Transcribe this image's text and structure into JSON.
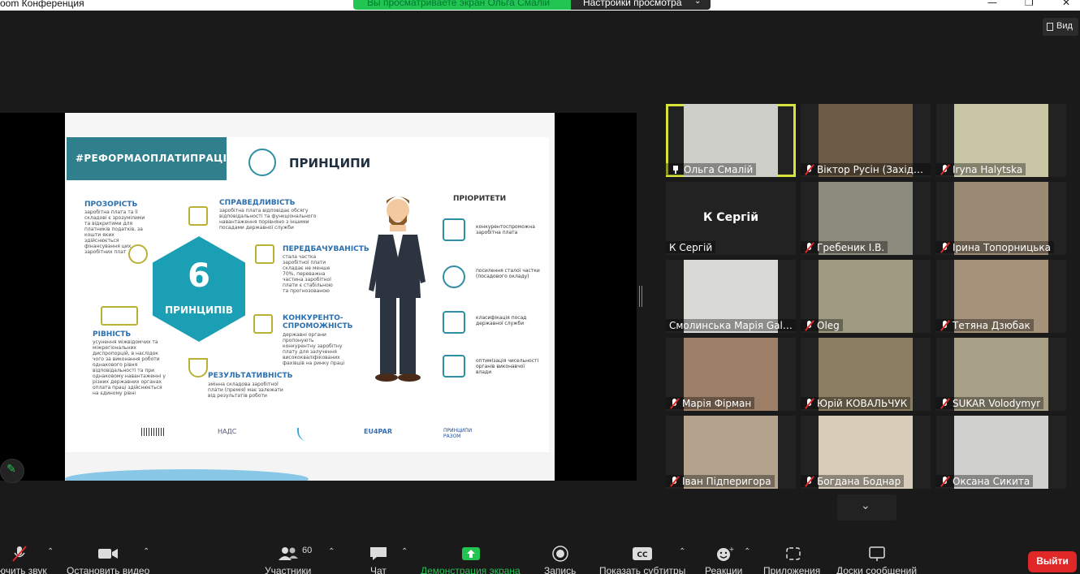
{
  "window": {
    "title": "oom Конференция",
    "share_banner": "Вы просматриваете экран Ольга Смалій",
    "view_settings": "Настройки просмотра",
    "view_button": "Вид"
  },
  "slide": {
    "hashtag": "#РЕФОРМАОПЛАТИПРАЦІ",
    "title": "ПРИНЦИПИ",
    "hex_number": "6",
    "hex_label": "ПРИНЦИПІВ",
    "principles": [
      {
        "heading": "ПРОЗОРІСТЬ",
        "text": "заробітна плата та її складові є зрозумілими та відкритими для платників податків, за кошти яких здійснюється фінансування цих заробітних плат"
      },
      {
        "heading": "СПРАВЕДЛИВІСТЬ",
        "text": "заробітна плата відповідає обсягу відповідальності та функціонального навантаження порівняно з іншими посадами державної служби"
      },
      {
        "heading": "ПЕРЕДБАЧУВАНІСТЬ",
        "text": "стала частка заробітної плати складає не менше 70%, переважна частина заробітної плати є стабільною та прогнозованою"
      },
      {
        "heading": "КОНКУРЕНТО-СПРОМОЖНІСТЬ",
        "text": "державні органи пропонують конкурентну заробітну плату для залучення висококваліфікованих фахівців на ринку праці"
      },
      {
        "heading": "РЕЗУЛЬТАТИВНІСТЬ",
        "text": "змінна складова заробітної плати (премія) має залежати від результатів роботи"
      },
      {
        "heading": "РІВНІСТЬ",
        "text": "усунення міжвідомчих та міжрегіональних диспропорцій, в наслідок чого за виконання роботи однакового рівня відповідальності та при однаковому навантаженні у різних державних органах оплата праці здійснюється на єдиному рівні"
      }
    ],
    "priorities_title": "ПРІОРИТЕТИ",
    "priorities": [
      "конкурентоспроможна заробітна плата",
      "посилення сталої частки (посадового окладу)",
      "класифікація посад державної служби",
      "оптимізація чисельності органів виконавчої влади"
    ],
    "logos": [
      "НАДС",
      "EU4PAR",
      "ПРИНЦИПИ РАЗОМ"
    ]
  },
  "participants": [
    {
      "name": "Ольга Смалій",
      "muted": false,
      "pinned": true,
      "active": true,
      "bg": "#cfcfc9"
    },
    {
      "name": "Віктор Русін (Західно...",
      "muted": true,
      "bg": "#6b5a44"
    },
    {
      "name": "Iryna Halytska",
      "muted": true,
      "bg": "#c9c6a5"
    },
    {
      "name": "К Сергій",
      "muted": false,
      "bg": "#222222",
      "avatar_text": "К Сергій"
    },
    {
      "name": "Гребеник І.В.",
      "muted": true,
      "bg": "#8c8a7c"
    },
    {
      "name": "Ірина Топорницька",
      "muted": true,
      "bg": "#9b8b74"
    },
    {
      "name": "Смолинська Марія Gala...",
      "muted": false,
      "bg": "#d9d9d6"
    },
    {
      "name": "Oleg",
      "muted": true,
      "bg": "#9e9b82"
    },
    {
      "name": "Тетяна Дзюбак",
      "muted": true,
      "bg": "#a6927a"
    },
    {
      "name": "Марія Фірман",
      "muted": true,
      "bg": "#9c7f66"
    },
    {
      "name": "Юрій КОВАЛЬЧУК",
      "muted": true,
      "bg": "#8a7d62"
    },
    {
      "name": "SUKAR Volodymyr",
      "muted": true,
      "bg": "#a89f87"
    },
    {
      "name": "Іван Підперигора",
      "muted": true,
      "bg": "#b3a38c"
    },
    {
      "name": "Богдана Боднар",
      "muted": true,
      "bg": "#d8cdb8"
    },
    {
      "name": "Оксана Сикита",
      "muted": true,
      "bg": "#d0d0ce"
    }
  ],
  "toolbar": {
    "mute": "ючить звук",
    "video": "Остановить видео",
    "participants": "Участники",
    "participants_count": "60",
    "chat": "Чат",
    "share": "Демонстрация экрана",
    "record": "Запись",
    "captions": "Показать субтитры",
    "reactions": "Реакции",
    "apps": "Приложения",
    "whiteboards": "Доски сообщений",
    "end": "Выйти"
  },
  "colors": {
    "banner_green": "#23c552",
    "end_red": "#e02828",
    "active_speaker": "#d8e33b",
    "slide_teal": "#1a9fb5"
  }
}
